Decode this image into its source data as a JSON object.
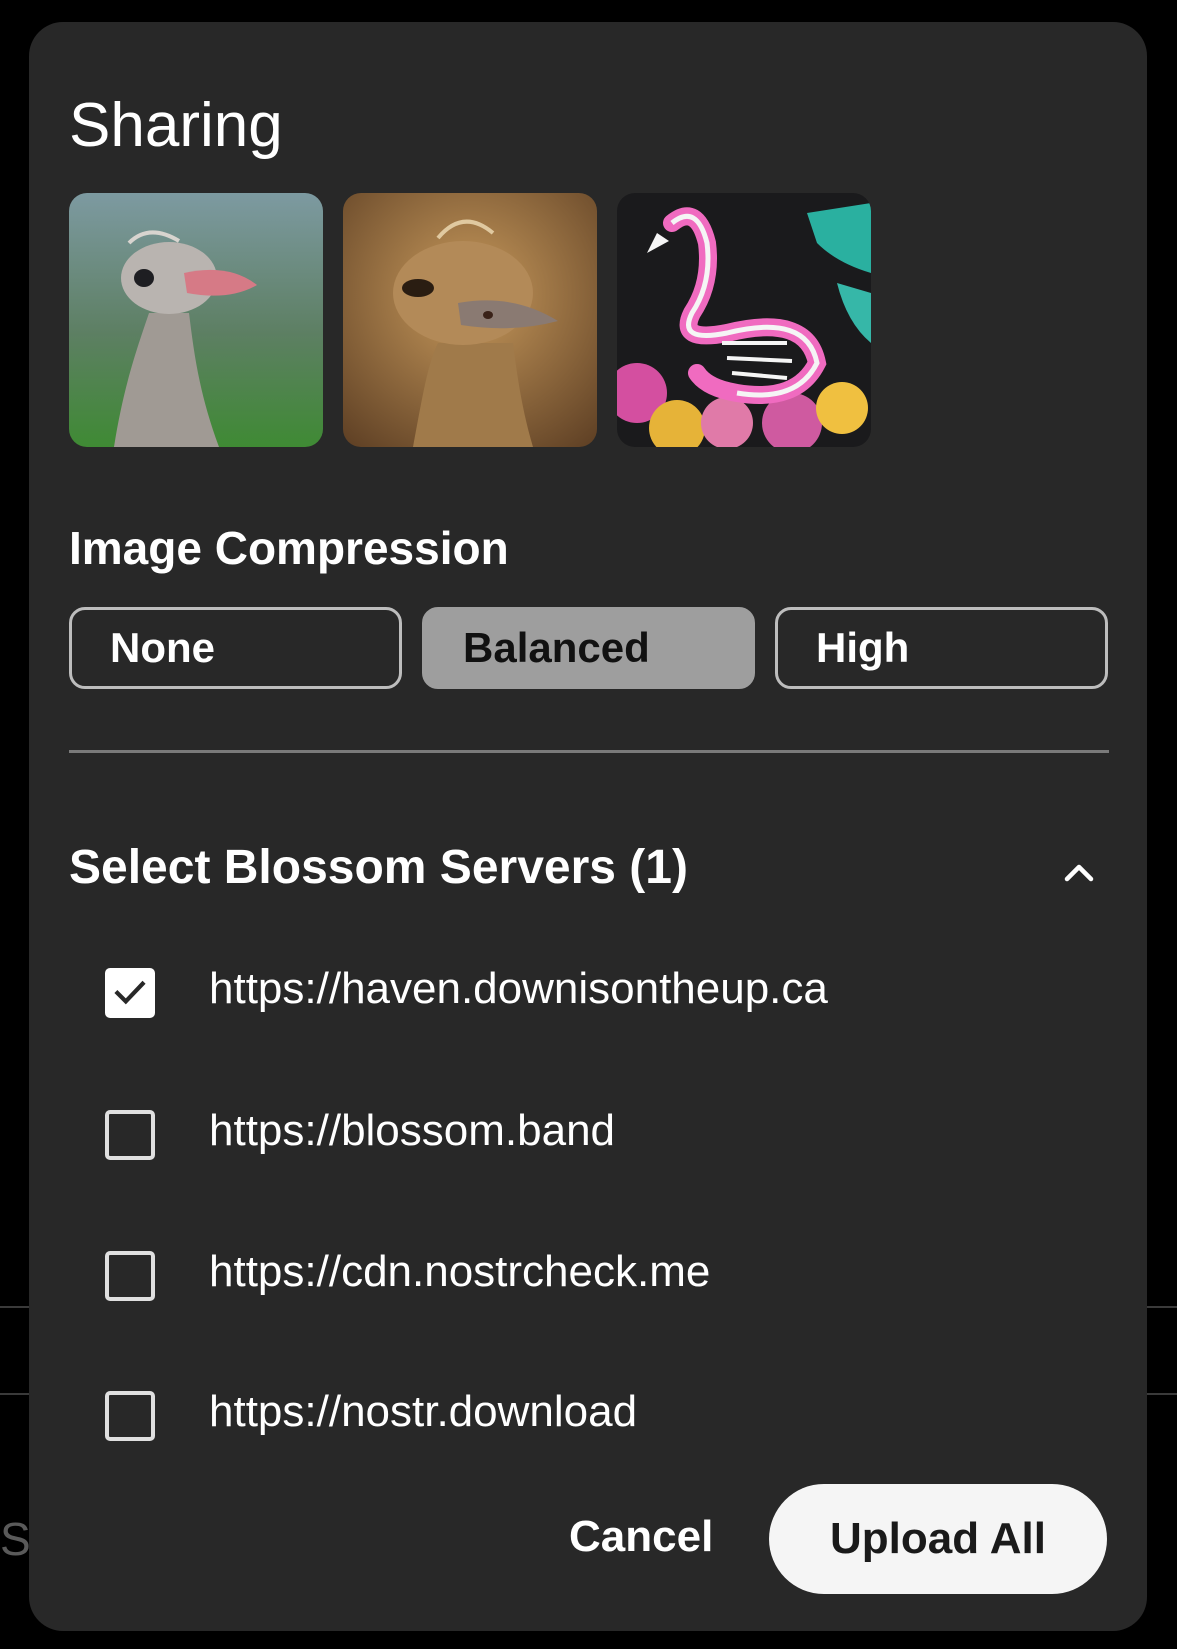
{
  "background": {
    "partial_text": "S"
  },
  "dialog": {
    "title": "Sharing",
    "thumbnails": [
      {
        "name": "ostrich-photo-1"
      },
      {
        "name": "ostrich-photo-2"
      },
      {
        "name": "flamingo-skeleton-mural"
      }
    ],
    "compression": {
      "label": "Image Compression",
      "options": [
        "None",
        "Balanced",
        "High"
      ],
      "selected": "Balanced"
    },
    "servers": {
      "title": "Select Blossom Servers (1)",
      "expanded": true,
      "items": [
        {
          "url": "https://haven.downisontheup.ca",
          "checked": true
        },
        {
          "url": "https://blossom.band",
          "checked": false
        },
        {
          "url": "https://cdn.nostrcheck.me",
          "checked": false
        },
        {
          "url": "https://nostr.download",
          "checked": false
        }
      ]
    },
    "actions": {
      "cancel_label": "Cancel",
      "upload_label": "Upload All"
    }
  },
  "colors": {
    "dialog_bg": "#282828",
    "selected_segment": "#9e9e9e",
    "primary_button": "#f5f5f5"
  }
}
